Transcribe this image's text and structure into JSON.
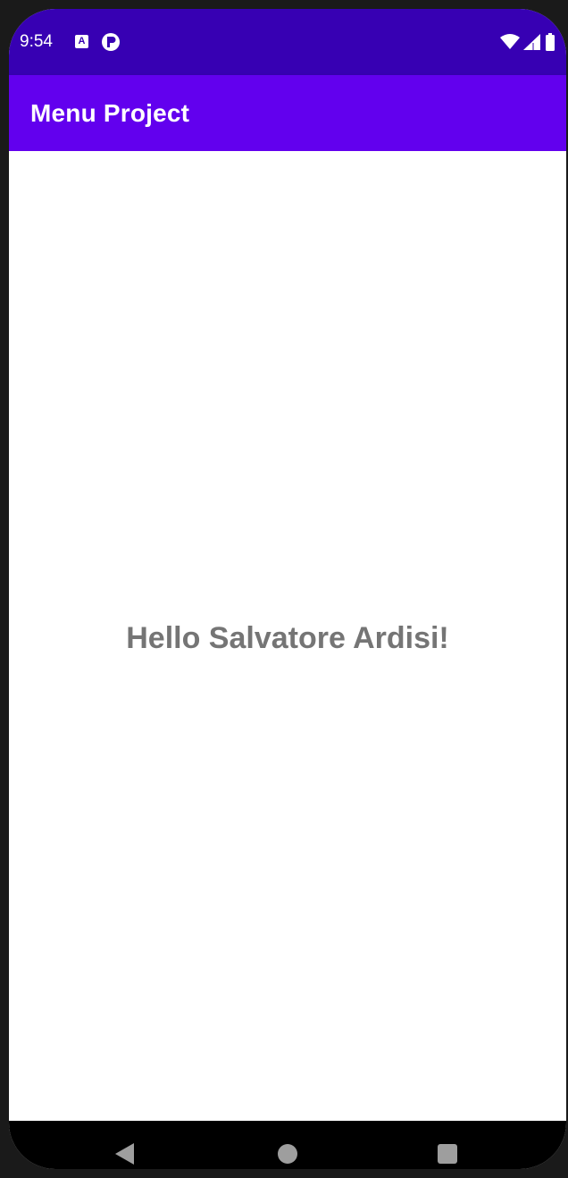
{
  "status_bar": {
    "time": "9:54",
    "icons": [
      "android-auto-icon",
      "app-notification-icon",
      "wifi-icon",
      "cellular-signal-icon",
      "battery-icon"
    ],
    "background_color": "#3700b3"
  },
  "app_bar": {
    "title": "Menu Project",
    "background_color": "#6200ee"
  },
  "main": {
    "greeting": "Hello Salvatore Ardisi!",
    "text_color": "#757575"
  },
  "nav_bar": {
    "icons": [
      "back-icon",
      "home-icon",
      "recents-icon"
    ]
  }
}
